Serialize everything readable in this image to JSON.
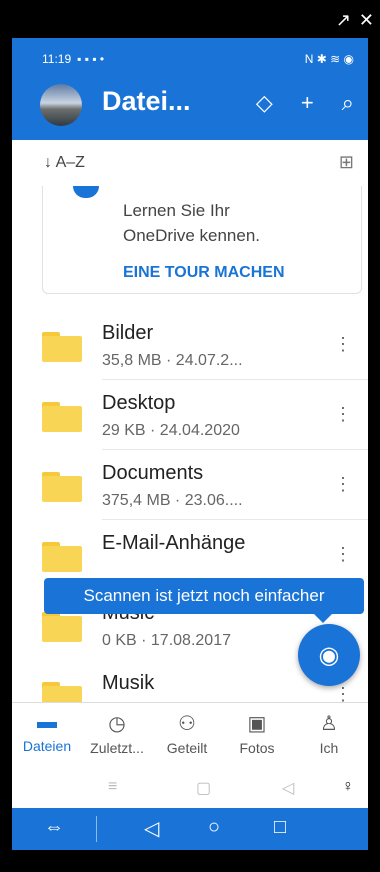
{
  "window": {
    "external_icon": "↗",
    "close_icon": "✕"
  },
  "status": {
    "time": "11:19",
    "left_icons": "▪ ▪ ▪ •",
    "right_icons": "N ✱ ≋ ◉"
  },
  "header": {
    "title": "Datei...",
    "premium_icon": "◇",
    "add_icon": "+",
    "search_icon": "⌕"
  },
  "sort": {
    "label": "↓ A–Z",
    "view_icon": "⊞"
  },
  "tour": {
    "text_line1": "Lernen Sie Ihr",
    "text_line2": "OneDrive kennen.",
    "link": "EINE TOUR MACHEN"
  },
  "files": [
    {
      "name": "Bilder",
      "meta": "35,8 MB · 24.07.2..."
    },
    {
      "name": "Desktop",
      "meta": "29 KB · 24.04.2020"
    },
    {
      "name": "Documents",
      "meta": "375,4 MB · 23.06...."
    },
    {
      "name": "E-Mail-Anhänge",
      "meta": ""
    },
    {
      "name": "Music",
      "meta": "0 KB · 17.08.2017"
    },
    {
      "name": "Musik",
      "meta": ""
    }
  ],
  "tooltip": "Scannen ist jetzt noch einfacher",
  "fab_icon": "◉",
  "nav": [
    {
      "label": "Dateien",
      "icon": "▬"
    },
    {
      "label": "Zuletzt...",
      "icon": "◷"
    },
    {
      "label": "Geteilt",
      "icon": "⚇"
    },
    {
      "label": "Fotos",
      "icon": "▣"
    },
    {
      "label": "Ich",
      "icon": "♙"
    }
  ],
  "sysnav1": {
    "menu": "≡",
    "home": "▢",
    "back": "◁",
    "access": "♀"
  },
  "sysnav2": {
    "swap": "⇔",
    "back": "◁",
    "home": "○",
    "recents": "□"
  }
}
